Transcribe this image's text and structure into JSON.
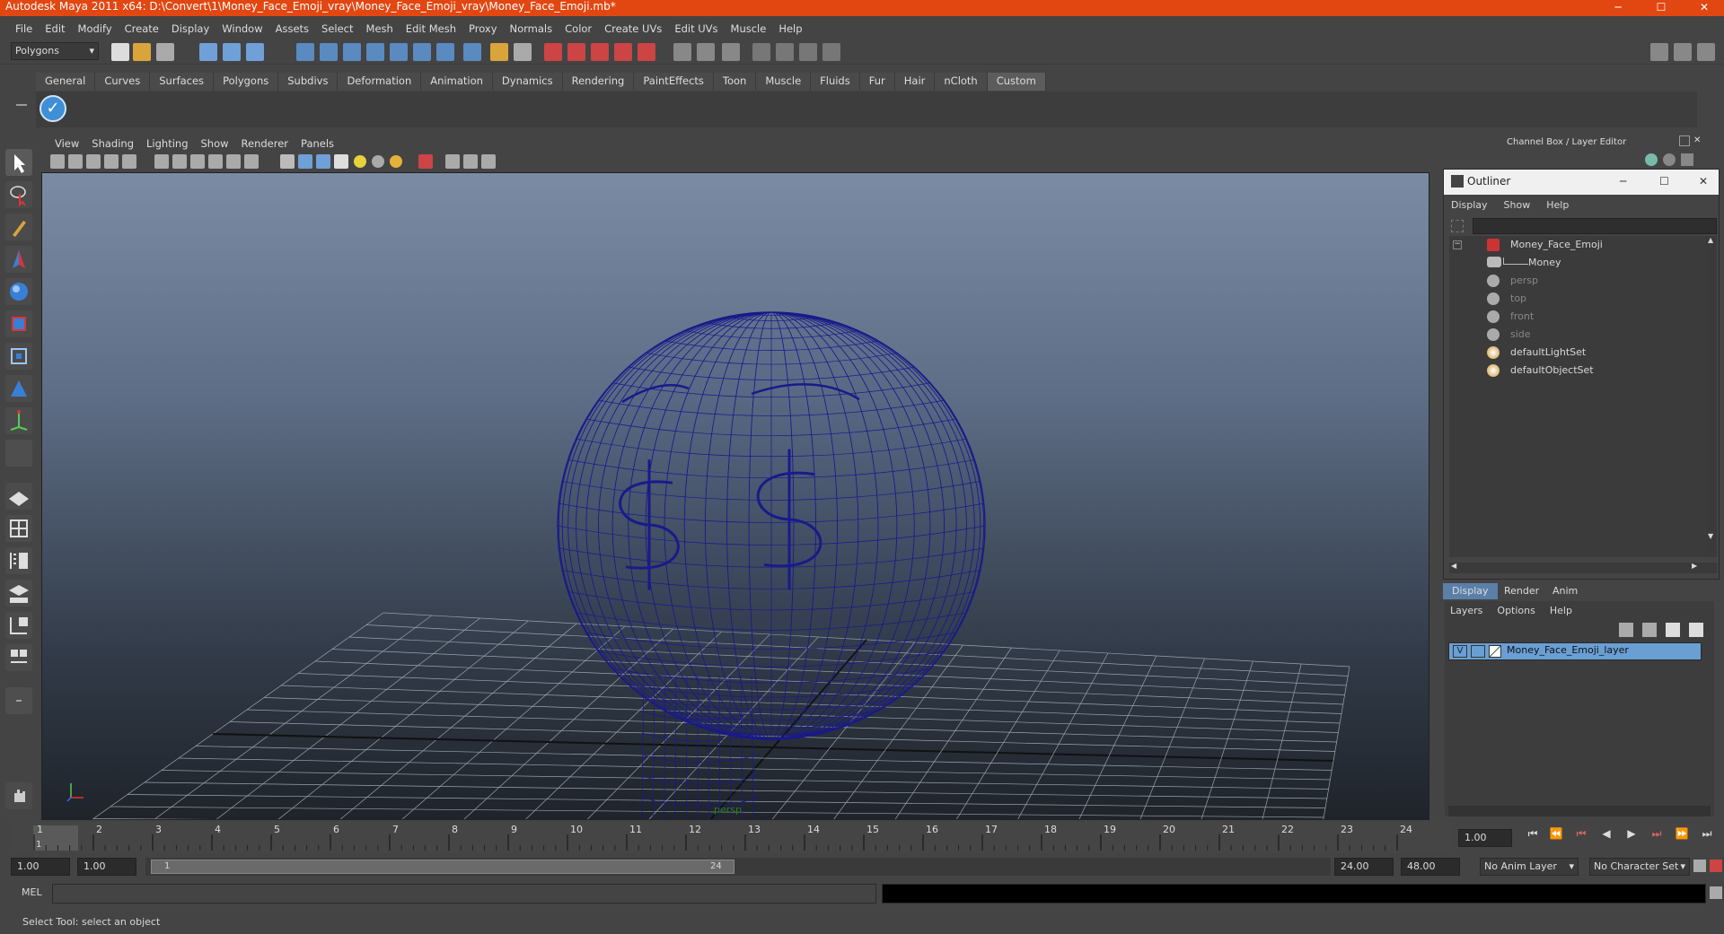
{
  "title": "Autodesk Maya 2011 x64: D:\\Convert\\1\\Money_Face_Emoji_vray\\Money_Face_Emoji_vray\\Money_Face_Emoji.mb*",
  "window_controls": {
    "minimize": "─",
    "maximize": "☐",
    "close": "✕"
  },
  "menubar": [
    "File",
    "Edit",
    "Modify",
    "Create",
    "Display",
    "Window",
    "Assets",
    "Select",
    "Mesh",
    "Edit Mesh",
    "Proxy",
    "Normals",
    "Color",
    "Create UVs",
    "Edit UVs",
    "Muscle",
    "Help"
  ],
  "menuset": "Polygons",
  "shelf_tabs": [
    "General",
    "Curves",
    "Surfaces",
    "Polygons",
    "Subdivs",
    "Deformation",
    "Animation",
    "Dynamics",
    "Rendering",
    "PaintEffects",
    "Toon",
    "Muscle",
    "Fluids",
    "Fur",
    "Hair",
    "nCloth",
    "Custom"
  ],
  "active_shelf_tab": "Custom",
  "viewport_menu": [
    "View",
    "Shading",
    "Lighting",
    "Show",
    "Renderer",
    "Panels"
  ],
  "viewport_camera_label": "persp",
  "channel_box_title": "Channel Box / Layer Editor",
  "outliner": {
    "title": "Outliner",
    "menu": [
      "Display",
      "Show",
      "Help"
    ],
    "items": [
      {
        "label": "Money_Face_Emoji",
        "dim": false
      },
      {
        "label": "Money",
        "dim": false
      },
      {
        "label": "persp",
        "dim": true
      },
      {
        "label": "top",
        "dim": true
      },
      {
        "label": "front",
        "dim": true
      },
      {
        "label": "side",
        "dim": true
      },
      {
        "label": "defaultLightSet",
        "dim": false
      },
      {
        "label": "defaultObjectSet",
        "dim": false
      }
    ]
  },
  "layer_editor": {
    "tabs": [
      "Display",
      "Render",
      "Anim"
    ],
    "menu": [
      "Layers",
      "Options",
      "Help"
    ],
    "layer": {
      "visible": "V",
      "name": "Money_Face_Emoji_layer"
    }
  },
  "timeline": {
    "ticks": [
      "1",
      "2",
      "3",
      "4",
      "5",
      "6",
      "7",
      "8",
      "9",
      "10",
      "11",
      "12",
      "13",
      "14",
      "15",
      "16",
      "17",
      "18",
      "19",
      "20",
      "21",
      "22",
      "23",
      "24"
    ],
    "current_frame": "1.00",
    "frame_marker": "1"
  },
  "range": {
    "start": "1.00",
    "anim_start": "1.00",
    "slider_start": "1",
    "slider_end": "24",
    "anim_end": "24.00",
    "end": "48.00",
    "anim_layer": "No Anim Layer",
    "character_set": "No Character Set"
  },
  "command_line": {
    "label": "MEL"
  },
  "help_line": "Select Tool: select an object",
  "colors": {
    "title_bar": "#e24712",
    "wireframe": "#1a1a8a",
    "selected_layer": "#6a9fd4"
  }
}
